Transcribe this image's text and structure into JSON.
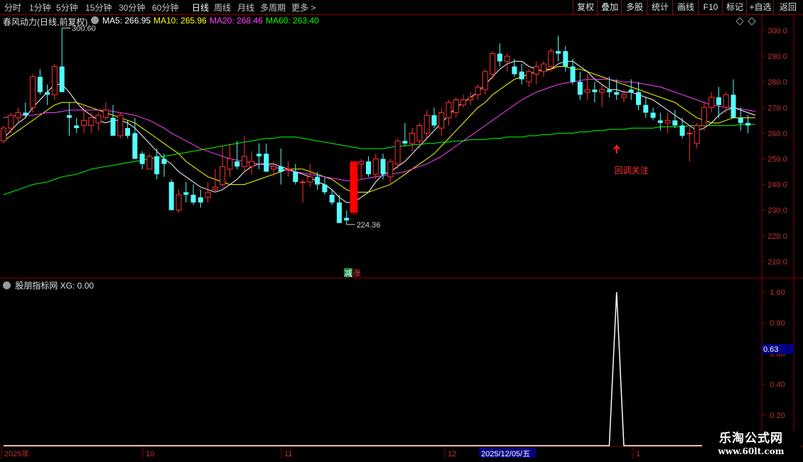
{
  "toolbar": {
    "periods": [
      "分时",
      "1分钟",
      "5分钟",
      "15分钟",
      "30分钟",
      "60分钟",
      "日线",
      "周线",
      "月线",
      "多周期",
      "更多 >"
    ],
    "active_period": "日线",
    "right_buttons": [
      "复权",
      "叠加",
      "多股",
      "统计",
      "画线",
      "F10",
      "标记",
      "+自选",
      "返回"
    ]
  },
  "info": {
    "title": "春风动力(日线,前复权)",
    "ma5": "MA5: 266.95",
    "ma10": "MA10: 265.96",
    "ma20": "MA20: 268.46",
    "ma60": "MA60: 263.40",
    "colors": {
      "ma5": "#ffffff",
      "ma10": "#ffff00",
      "ma20": "#ff40ff",
      "ma60": "#00ff00"
    }
  },
  "price_axis": {
    "labels": [
      "300.0",
      "290.0",
      "280.0",
      "270.0",
      "260.0",
      "250.0",
      "240.0",
      "230.0",
      "220.0",
      "210.0"
    ],
    "values": [
      300,
      290,
      280,
      270,
      260,
      250,
      240,
      230,
      220,
      210
    ]
  },
  "annotations": {
    "high": "300.60",
    "low": "224.36",
    "limit_badge": "涨",
    "limit_badge_prefix": "减",
    "callout": "回调关注"
  },
  "indicator": {
    "title": "股朋指标网 XG: 0.00",
    "axis_labels": [
      "1.00",
      "0.80",
      "0.60",
      "0.40",
      "0.20"
    ],
    "axis_values": [
      1.0,
      0.8,
      0.6,
      0.4,
      0.2
    ],
    "cursor_value": "0.63"
  },
  "time_axis": {
    "labels": [
      "2025年",
      "10",
      "11",
      "12",
      "1"
    ],
    "highlight_date": "2025/12/05/五"
  },
  "watermark": {
    "line1": "乐淘公式网",
    "line2": "www.60lt.com"
  },
  "chart_data": {
    "type": "candlestick",
    "ylim": [
      205,
      305
    ],
    "candles": [
      {
        "o": 257,
        "h": 263,
        "l": 256,
        "c": 262
      },
      {
        "o": 262,
        "h": 268,
        "l": 260,
        "c": 267
      },
      {
        "o": 266,
        "h": 270,
        "l": 264,
        "c": 268
      },
      {
        "o": 268,
        "h": 272,
        "l": 266,
        "c": 267
      },
      {
        "o": 270,
        "h": 283,
        "l": 268,
        "c": 282
      },
      {
        "o": 282,
        "h": 285,
        "l": 275,
        "c": 276
      },
      {
        "o": 276,
        "h": 279,
        "l": 271,
        "c": 275
      },
      {
        "o": 275,
        "h": 287,
        "l": 273,
        "c": 286
      },
      {
        "o": 286,
        "h": 301,
        "l": 277,
        "c": 276
      },
      {
        "o": 267,
        "h": 272,
        "l": 259,
        "c": 266
      },
      {
        "o": 263,
        "h": 266,
        "l": 260,
        "c": 262
      },
      {
        "o": 263,
        "h": 271,
        "l": 260,
        "c": 265
      },
      {
        "o": 263,
        "h": 268,
        "l": 260,
        "c": 266
      },
      {
        "o": 264,
        "h": 268,
        "l": 261,
        "c": 267
      },
      {
        "o": 266,
        "h": 272,
        "l": 265,
        "c": 269
      },
      {
        "o": 266,
        "h": 271,
        "l": 260,
        "c": 259
      },
      {
        "o": 259,
        "h": 268,
        "l": 258,
        "c": 267
      },
      {
        "o": 262,
        "h": 265,
        "l": 258,
        "c": 259
      },
      {
        "o": 260,
        "h": 266,
        "l": 250,
        "c": 250
      },
      {
        "o": 252,
        "h": 253,
        "l": 246,
        "c": 248
      },
      {
        "o": 246,
        "h": 252,
        "l": 246,
        "c": 251
      },
      {
        "o": 251,
        "h": 254,
        "l": 242,
        "c": 244
      },
      {
        "o": 250,
        "h": 252,
        "l": 243,
        "c": 248
      },
      {
        "o": 241,
        "h": 242,
        "l": 230,
        "c": 230
      },
      {
        "o": 230,
        "h": 238,
        "l": 229,
        "c": 236
      },
      {
        "o": 237,
        "h": 241,
        "l": 233,
        "c": 236
      },
      {
        "o": 236,
        "h": 240,
        "l": 232,
        "c": 233
      },
      {
        "o": 235,
        "h": 238,
        "l": 231,
        "c": 233
      },
      {
        "o": 235,
        "h": 241,
        "l": 233,
        "c": 237
      },
      {
        "o": 238,
        "h": 246,
        "l": 237,
        "c": 239
      },
      {
        "o": 240,
        "h": 255,
        "l": 239,
        "c": 247
      },
      {
        "o": 246,
        "h": 256,
        "l": 243,
        "c": 250
      },
      {
        "o": 249,
        "h": 257,
        "l": 246,
        "c": 247
      },
      {
        "o": 247,
        "h": 259,
        "l": 245,
        "c": 251
      },
      {
        "o": 247,
        "h": 253,
        "l": 244,
        "c": 249
      },
      {
        "o": 252,
        "h": 256,
        "l": 246,
        "c": 251
      },
      {
        "o": 252,
        "h": 256,
        "l": 248,
        "c": 245
      },
      {
        "o": 246,
        "h": 249,
        "l": 243,
        "c": 247
      },
      {
        "o": 247,
        "h": 254,
        "l": 240,
        "c": 245
      },
      {
        "o": 246,
        "h": 249,
        "l": 243,
        "c": 246
      },
      {
        "o": 245,
        "h": 248,
        "l": 240,
        "c": 241
      },
      {
        "o": 241,
        "h": 242,
        "l": 233,
        "c": 241
      },
      {
        "o": 241,
        "h": 248,
        "l": 239,
        "c": 243
      },
      {
        "o": 243,
        "h": 245,
        "l": 238,
        "c": 240
      },
      {
        "o": 240,
        "h": 243,
        "l": 236,
        "c": 237
      },
      {
        "o": 236,
        "h": 238,
        "l": 232,
        "c": 233
      },
      {
        "o": 233,
        "h": 236,
        "l": 227,
        "c": 225
      },
      {
        "o": 227,
        "h": 230,
        "l": 224.4,
        "c": 226
      },
      {
        "o": 229,
        "h": 249,
        "l": 228,
        "c": 249
      },
      {
        "o": 248,
        "h": 250,
        "l": 242,
        "c": 249
      },
      {
        "o": 249,
        "h": 251,
        "l": 243,
        "c": 244
      },
      {
        "o": 244,
        "h": 252,
        "l": 242,
        "c": 250
      },
      {
        "o": 250,
        "h": 252,
        "l": 242,
        "c": 244
      },
      {
        "o": 243,
        "h": 250,
        "l": 240,
        "c": 249
      },
      {
        "o": 248,
        "h": 258,
        "l": 246,
        "c": 257
      },
      {
        "o": 257,
        "h": 264,
        "l": 255,
        "c": 256
      },
      {
        "o": 256,
        "h": 262,
        "l": 253,
        "c": 260
      },
      {
        "o": 257,
        "h": 264,
        "l": 254,
        "c": 263
      },
      {
        "o": 260,
        "h": 269,
        "l": 258,
        "c": 267
      },
      {
        "o": 267,
        "h": 270,
        "l": 262,
        "c": 263
      },
      {
        "o": 262,
        "h": 270,
        "l": 259,
        "c": 268
      },
      {
        "o": 266,
        "h": 273,
        "l": 263,
        "c": 272
      },
      {
        "o": 268,
        "h": 274,
        "l": 266,
        "c": 273
      },
      {
        "o": 271,
        "h": 275,
        "l": 270,
        "c": 273
      },
      {
        "o": 273,
        "h": 276,
        "l": 271,
        "c": 274
      },
      {
        "o": 275,
        "h": 279,
        "l": 273,
        "c": 278
      },
      {
        "o": 277,
        "h": 285,
        "l": 275,
        "c": 284
      },
      {
        "o": 283,
        "h": 292,
        "l": 281,
        "c": 291
      },
      {
        "o": 291,
        "h": 295,
        "l": 286,
        "c": 288
      },
      {
        "o": 288,
        "h": 291,
        "l": 284,
        "c": 290
      },
      {
        "o": 286,
        "h": 289,
        "l": 282,
        "c": 283
      },
      {
        "o": 284,
        "h": 287,
        "l": 279,
        "c": 281
      },
      {
        "o": 280,
        "h": 285,
        "l": 278,
        "c": 284
      },
      {
        "o": 283,
        "h": 288,
        "l": 279,
        "c": 286
      },
      {
        "o": 284,
        "h": 288,
        "l": 282,
        "c": 287
      },
      {
        "o": 286,
        "h": 293,
        "l": 284,
        "c": 292
      },
      {
        "o": 292,
        "h": 298,
        "l": 288,
        "c": 291
      },
      {
        "o": 292,
        "h": 294,
        "l": 284,
        "c": 286
      },
      {
        "o": 286,
        "h": 289,
        "l": 279,
        "c": 280
      },
      {
        "o": 280,
        "h": 284,
        "l": 273,
        "c": 275
      },
      {
        "o": 276,
        "h": 283,
        "l": 273,
        "c": 277
      },
      {
        "o": 277,
        "h": 280,
        "l": 272,
        "c": 276
      },
      {
        "o": 276,
        "h": 279,
        "l": 270,
        "c": 277
      },
      {
        "o": 277,
        "h": 282,
        "l": 274,
        "c": 276
      },
      {
        "o": 276,
        "h": 281,
        "l": 273,
        "c": 275
      },
      {
        "o": 274,
        "h": 277,
        "l": 272,
        "c": 275
      },
      {
        "o": 277,
        "h": 281,
        "l": 273,
        "c": 276
      },
      {
        "o": 276,
        "h": 280,
        "l": 269,
        "c": 271
      },
      {
        "o": 271,
        "h": 274,
        "l": 266,
        "c": 268
      },
      {
        "o": 268,
        "h": 270,
        "l": 265,
        "c": 266
      },
      {
        "o": 265,
        "h": 268,
        "l": 261,
        "c": 264
      },
      {
        "o": 264,
        "h": 268,
        "l": 260,
        "c": 265
      },
      {
        "o": 265,
        "h": 269,
        "l": 262,
        "c": 263
      },
      {
        "o": 263,
        "h": 266,
        "l": 258,
        "c": 259
      },
      {
        "o": 260,
        "h": 263,
        "l": 249,
        "c": 260
      },
      {
        "o": 256,
        "h": 264,
        "l": 254,
        "c": 263
      },
      {
        "o": 263,
        "h": 272,
        "l": 261,
        "c": 270
      },
      {
        "o": 270,
        "h": 276,
        "l": 268,
        "c": 274
      },
      {
        "o": 274,
        "h": 278,
        "l": 266,
        "c": 271
      },
      {
        "o": 270,
        "h": 276,
        "l": 268,
        "c": 275
      },
      {
        "o": 275,
        "h": 281,
        "l": 271,
        "c": 266
      },
      {
        "o": 266,
        "h": 270,
        "l": 261,
        "c": 264
      },
      {
        "o": 264,
        "h": 267,
        "l": 260,
        "c": 263
      }
    ],
    "series": [
      {
        "name": "MA5",
        "values": [
          258,
          261,
          264,
          266,
          270,
          273,
          276,
          279,
          279,
          276,
          272,
          269,
          267,
          265,
          264,
          265,
          265,
          264,
          262,
          259,
          256,
          253,
          250,
          248,
          245,
          243,
          241,
          239,
          238,
          237,
          238,
          240,
          242,
          245,
          247,
          248,
          248,
          248,
          247,
          246,
          245,
          244,
          243,
          241,
          240,
          238,
          235,
          233,
          233,
          235,
          237,
          241,
          244,
          245,
          247,
          249,
          252,
          255,
          258,
          261,
          264,
          267,
          270,
          272,
          274,
          276,
          279,
          282,
          285,
          287,
          288,
          288,
          286,
          285,
          284,
          285,
          287,
          288,
          288,
          286,
          284,
          281,
          279,
          277,
          277,
          276,
          276,
          275,
          274,
          273,
          271,
          269,
          267,
          265,
          263,
          261,
          262,
          264,
          267,
          269,
          270,
          269,
          268,
          267
        ]
      },
      {
        "name": "MA10",
        "values": [
          257,
          259,
          261,
          263,
          265,
          267,
          269,
          271,
          272,
          272,
          272,
          271,
          270,
          269,
          268,
          267,
          266,
          265,
          264,
          262,
          260,
          258,
          256,
          254,
          252,
          249,
          247,
          245,
          243,
          242,
          241,
          240,
          240,
          240,
          241,
          242,
          243,
          244,
          245,
          246,
          246,
          246,
          245,
          244,
          243,
          242,
          240,
          238,
          237,
          237,
          237,
          238,
          239,
          240,
          242,
          244,
          246,
          248,
          250,
          252,
          255,
          258,
          261,
          264,
          267,
          270,
          272,
          275,
          277,
          279,
          281,
          282,
          283,
          284,
          285,
          285,
          286,
          286,
          285,
          285,
          284,
          283,
          282,
          281,
          280,
          279,
          278,
          277,
          276,
          275,
          274,
          273,
          272,
          270,
          268,
          266,
          265,
          264,
          264,
          265,
          266,
          266,
          266,
          266
        ]
      },
      {
        "name": "MA20",
        "values": [
          266,
          266.5,
          267,
          267,
          267,
          267.5,
          268,
          268,
          268.5,
          269,
          269,
          269,
          269,
          269,
          269,
          268.5,
          268,
          267.5,
          267,
          266,
          265,
          263.5,
          262,
          260,
          258.5,
          257,
          255.5,
          254,
          253,
          252,
          251,
          250,
          249.5,
          249,
          248.5,
          248,
          247.5,
          247,
          246,
          245.5,
          245,
          244.5,
          244,
          243.5,
          243,
          242.5,
          242,
          241.5,
          241.5,
          242,
          242.5,
          243,
          243.5,
          244,
          244.5,
          245,
          246,
          247,
          248,
          249.5,
          251,
          253,
          255,
          257,
          259,
          261,
          263,
          265,
          267,
          269,
          271,
          273,
          274.5,
          276,
          277,
          278,
          279,
          279.5,
          280,
          280.5,
          281,
          281,
          281,
          281,
          280.5,
          280,
          280,
          279.5,
          279,
          278.5,
          278,
          277,
          276,
          275,
          274,
          273,
          272,
          271,
          270.5,
          270,
          270,
          269.5,
          269,
          268.5
        ]
      },
      {
        "name": "MA60",
        "values": [
          236,
          237,
          238,
          239,
          240,
          240.5,
          241,
          242,
          243,
          243.5,
          244,
          245,
          246,
          246.5,
          247,
          247.5,
          248,
          248.5,
          249,
          249.5,
          250,
          250.5,
          251,
          251.5,
          252,
          252.5,
          253,
          253.5,
          254,
          254.5,
          255,
          255.5,
          256,
          256.5,
          257,
          257.5,
          258,
          258,
          258.5,
          258.5,
          258.5,
          258,
          257.5,
          257,
          256.5,
          256,
          255.5,
          255,
          254.5,
          254,
          254,
          254,
          254,
          254.5,
          255,
          255,
          255.5,
          255.5,
          256,
          256,
          256.5,
          256.5,
          257,
          257,
          257.5,
          257.5,
          257.5,
          258,
          258,
          258.5,
          258.5,
          258.5,
          259,
          259,
          259.5,
          259.5,
          260,
          260,
          260,
          260.5,
          260.5,
          261,
          261,
          261.5,
          261.5,
          261.5,
          262,
          262,
          262,
          262,
          262.5,
          262.5,
          262.5,
          262.5,
          263,
          263,
          263,
          263,
          263,
          263,
          263,
          263.4,
          263.4,
          263.4
        ]
      }
    ],
    "highlight_candle_index": 48,
    "high_index": 8,
    "low_index": 47,
    "xg_peak_index": 84,
    "xg": {
      "peak_value": 1.0,
      "ylim": [
        0,
        1.05
      ]
    }
  }
}
